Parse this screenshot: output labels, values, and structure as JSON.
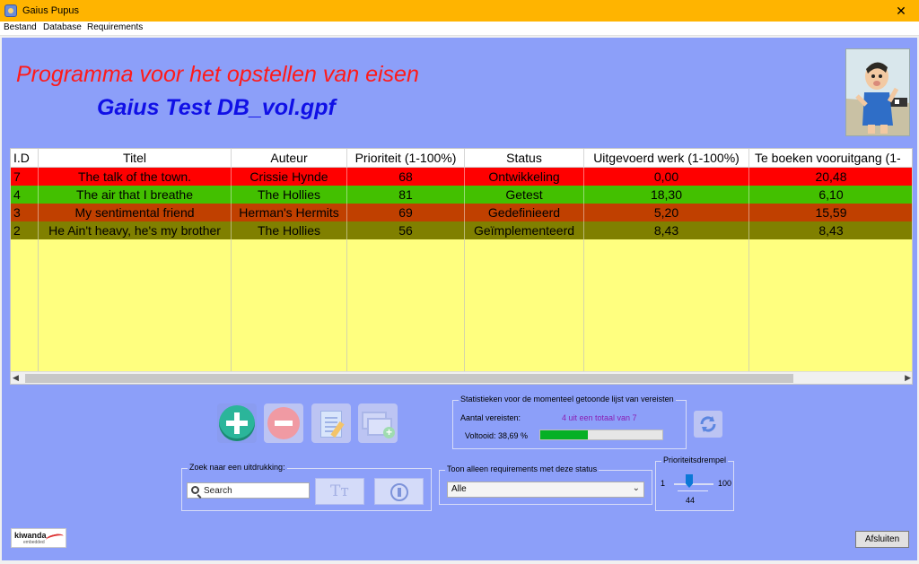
{
  "window": {
    "title": "Gaius Pupus",
    "close_glyph": "✕"
  },
  "menu": {
    "items": [
      "Bestand",
      "Database",
      "Requirements"
    ]
  },
  "header": {
    "subtitle": "Programma voor het opstellen van eisen",
    "db_name": "Gaius Test DB_vol.gpf"
  },
  "table": {
    "columns": [
      "I.D",
      "Titel",
      "Auteur",
      "Prioriteit (1-100%)",
      "Status",
      "Uitgevoerd werk (1-100%)",
      "Te boeken vooruitgang (1-"
    ],
    "rows": [
      {
        "id": "7",
        "title": "The talk of the town.",
        "author": "Crissie Hynde",
        "priority": "68",
        "status": "Ontwikkeling",
        "done": "0,00",
        "progress": "20,48",
        "color": "#ff0000"
      },
      {
        "id": "4",
        "title": "The air that I breathe",
        "author": "The Hollies",
        "priority": "81",
        "status": "Getest",
        "done": "18,30",
        "progress": "6,10",
        "color": "#43c000"
      },
      {
        "id": "3",
        "title": "My sentimental friend",
        "author": "Herman's Hermits",
        "priority": "69",
        "status": "Gedefinieerd",
        "done": "5,20",
        "progress": "15,59",
        "color": "#c04000"
      },
      {
        "id": "2",
        "title": "He Ain't heavy, he's my brother",
        "author": "The Hollies",
        "priority": "56",
        "status": "Geïmplementeerd",
        "done": "8,43",
        "progress": "8,43",
        "color": "#808000"
      }
    ]
  },
  "stats": {
    "legend": "Statistieken voor de momenteel getoonde lijst van vereisten",
    "count_label": "Aantal vereisten:",
    "count_value": "4 uit een totaal van 7",
    "completed_label": "Voltooid: 38,69 %",
    "completed_fraction": 0.3869
  },
  "search": {
    "legend": "Zoek naar een uitdrukking:",
    "placeholder": "Search",
    "case_button": "Tт"
  },
  "status_filter": {
    "legend": "Toon alleen requirements met deze status",
    "value": "Alle"
  },
  "priority": {
    "legend": "Prioriteitsdrempel",
    "min": "1",
    "max": "100",
    "value": "44"
  },
  "logo": {
    "name": "kiwanda",
    "sub": "embedded"
  },
  "footer": {
    "close_label": "Afsluiten"
  },
  "colors": {
    "background": "#8c9ff9",
    "title_bar": "#ffb400",
    "table_body": "#ffff7f",
    "subtitle": "#ff1a1a",
    "db_name": "#1010e6"
  },
  "icons": [
    "app-icon",
    "close-icon",
    "add-icon",
    "remove-icon",
    "edit-icon",
    "copy-icon",
    "refresh-icon",
    "search-icon",
    "case-icon",
    "exact-match-icon",
    "chevron-down-icon"
  ]
}
